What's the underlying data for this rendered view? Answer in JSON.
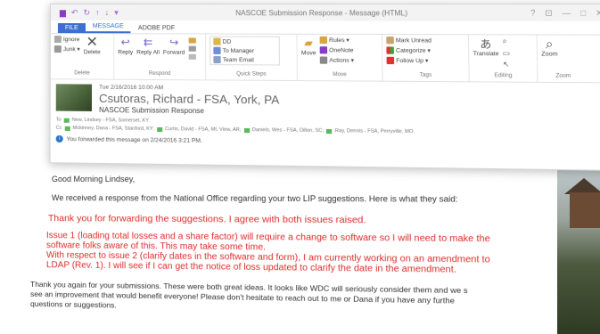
{
  "window": {
    "title": "NASCOE Submission Response - Message (HTML)",
    "controls": [
      "?",
      "⊡",
      "—",
      "□",
      "✕"
    ]
  },
  "tabs": [
    {
      "label": "FILE"
    },
    {
      "label": "MESSAGE"
    },
    {
      "label": "ADOBE PDF"
    }
  ],
  "ribbon": {
    "delete_group": {
      "label": "Delete",
      "ignore": "Ignore",
      "junk": "Junk ▾",
      "delete": "Delete"
    },
    "respond_group": {
      "label": "Respond",
      "reply": "Reply",
      "reply_all": "Reply All",
      "forward": "Forward"
    },
    "quick_steps_group": {
      "label": "Quick Steps",
      "items": [
        "DD",
        "To Manager",
        "Team Email"
      ]
    },
    "move_group": {
      "label": "Move",
      "move": "Move",
      "rules": "Rules ▾",
      "onenote": "OneNote",
      "actions": "Actions ▾"
    },
    "tags_group": {
      "label": "Tags",
      "unread": "Mark Unread",
      "categorize": "Categorize ▾",
      "followup": "Follow Up ▾"
    },
    "editing_group": {
      "label": "Editing",
      "translate": "Translate"
    },
    "zoom_group": {
      "label": "Zoom",
      "zoom": "Zoom"
    }
  },
  "header": {
    "date": "Tue 2/16/2016 10:00 AM",
    "sender": "Csutoras, Richard - FSA, York, PA",
    "subject": "NASCOE Submission Response",
    "to_label": "To",
    "to": "New, Lindsey - FSA, Somerset, KY",
    "cc_label": "Cc",
    "cc": [
      "Mckinney, Dana - FSA, Stanford, KY;",
      "Curtis, David - FSA, Mt. View, AR;",
      "Daniels, Wes - FSA, Dillon, SC;",
      "Ray, Dennis - FSA, Perryville, MO"
    ],
    "notice": "You forwarded this message on 2/24/2016 3:21 PM."
  },
  "body": {
    "greeting": "Good Morning Lindsey,",
    "intro": "We received a response from the National Office regarding your two LIP suggestions.  Here is what they said:",
    "red_line1": "Thank you for forwarding the suggestions.  I agree with both issues raised.",
    "red_para": [
      "Issue 1 (loading total losses and a share factor) will require a change to software so I will need to make the",
      "software folks aware of this.  This may take some time.",
      "With respect to issue 2 (clarify dates in the software and form), I am currently working on an amendment to",
      "LDAP (Rev. 1).  I will see if I can get the notice of loss updated to clarify the date in the amendment."
    ],
    "closing": [
      "Thank you again for your submissions.  These were both great ideas.  It looks like WDC will seriously consider them and we s",
      "see an improvement that would benefit everyone!  Please don't hesitate to reach out to me or Dana if you have any furthe",
      "questions or suggestions."
    ]
  }
}
